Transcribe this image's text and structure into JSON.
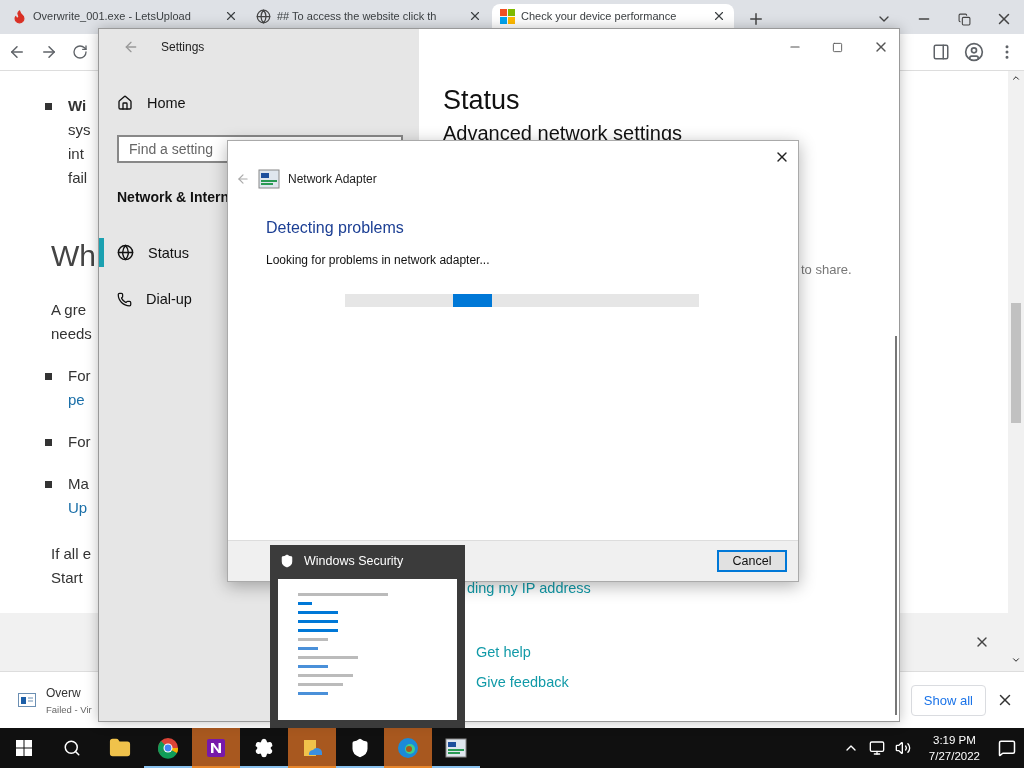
{
  "browser": {
    "tabs": [
      {
        "title": "Overwrite_001.exe - LetsUpload",
        "selected": false
      },
      {
        "title": "## To access the website click th",
        "selected": false
      },
      {
        "title": "Check your device performance",
        "selected": true
      }
    ],
    "article": [
      {
        "kind": "bullet",
        "lines": [
          {
            "text": "Wi",
            "kind": "bold"
          },
          {
            "text": "sys",
            "kind": "plain"
          },
          {
            "text": "int",
            "kind": "plain"
          },
          {
            "text": "fail",
            "kind": "plain"
          }
        ]
      },
      {
        "kind": "heading",
        "lines": [
          {
            "text": "Wh",
            "kind": "plain"
          }
        ]
      },
      {
        "kind": "paragraph",
        "lines": [
          {
            "text": "A gre",
            "kind": "plain"
          },
          {
            "text": "needs",
            "kind": "plain"
          }
        ]
      },
      {
        "kind": "bullet",
        "lines": [
          {
            "text": "For",
            "kind": "plain"
          },
          {
            "text": "pe",
            "kind": "link"
          }
        ]
      },
      {
        "kind": "bullet",
        "lines": [
          {
            "text": "For",
            "kind": "plain"
          }
        ]
      },
      {
        "kind": "bullet",
        "lines": [
          {
            "text": "Ma",
            "kind": "plain"
          },
          {
            "text": "Up",
            "kind": "link"
          }
        ]
      },
      {
        "kind": "paragraph",
        "lines": [
          {
            "text": "If all e",
            "kind": "plain"
          },
          {
            "text": "Start",
            "kind": "plain"
          }
        ]
      }
    ],
    "download": {
      "file": "Overw",
      "status": "Failed - Vir",
      "show_all": "Show all"
    }
  },
  "settings": {
    "title": "Settings",
    "home": "Home",
    "search": {
      "placeholder": "Find a setting"
    },
    "section": "Network & Intern",
    "nav": [
      {
        "label": "Status",
        "selected": true
      },
      {
        "label": "Dial-up",
        "selected": false
      }
    ],
    "heading": "Status",
    "subheading": "Advanced network settings",
    "share_text": "to share.",
    "ip_link": "ding my IP address",
    "help_links": [
      "Get help",
      "Give feedback"
    ]
  },
  "dialog": {
    "title": "Network Adapter",
    "heading": "Detecting problems",
    "message": "Looking for problems in network adapter...",
    "button": "Cancel"
  },
  "preview": {
    "title": "Windows Security"
  },
  "taskbar": {
    "apps": [
      {
        "kind": "folder",
        "running": false,
        "flashing": false
      },
      {
        "kind": "chrome",
        "running": true,
        "flashing": false
      },
      {
        "kind": "onenote",
        "running": true,
        "flashing": true
      },
      {
        "kind": "settings",
        "running": true,
        "flashing": false
      },
      {
        "kind": "explorer",
        "running": true,
        "flashing": true
      },
      {
        "kind": "security",
        "running": true,
        "flashing": false
      },
      {
        "kind": "edge",
        "running": true,
        "flashing": true
      },
      {
        "kind": "troubleshooter",
        "running": true,
        "flashing": false
      }
    ],
    "time": "3:19 PM",
    "date": "7/27/2022"
  }
}
